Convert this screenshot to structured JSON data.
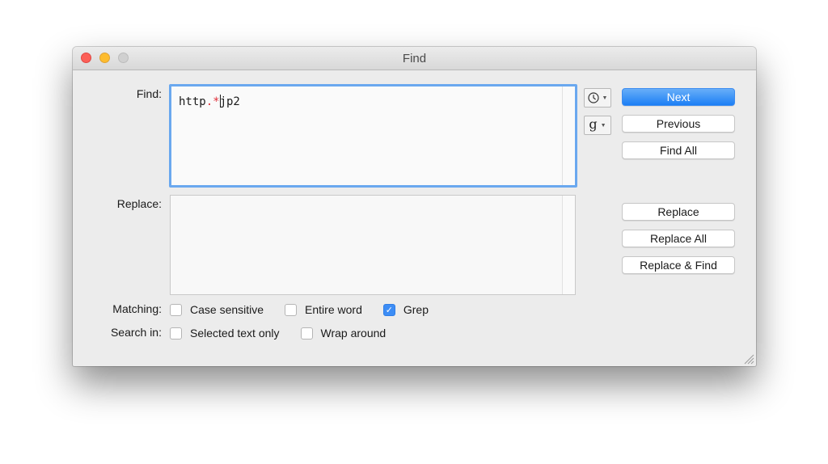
{
  "window": {
    "title": "Find"
  },
  "find": {
    "label": "Find:",
    "value_prefix": "http",
    "value_regex": ".*",
    "value_suffix": "jp2"
  },
  "replace": {
    "label": "Replace:",
    "value": ""
  },
  "popups": {
    "recent_icon": "clock-icon",
    "grep_patterns_glyph": "g"
  },
  "buttons": {
    "next": "Next",
    "previous": "Previous",
    "find_all": "Find All",
    "replace": "Replace",
    "replace_all": "Replace All",
    "replace_and_find": "Replace & Find"
  },
  "matching": {
    "label": "Matching:",
    "options": [
      {
        "label": "Case sensitive",
        "checked": false
      },
      {
        "label": "Entire word",
        "checked": false
      },
      {
        "label": "Grep",
        "checked": true
      }
    ]
  },
  "search_in": {
    "label": "Search in:",
    "options": [
      {
        "label": "Selected text only",
        "checked": false
      },
      {
        "label": "Wrap around",
        "checked": false
      }
    ]
  },
  "colors": {
    "accent": "#1c7ff5",
    "regex_highlight": "#e0303a",
    "focus_ring": "#6aa8ef"
  }
}
